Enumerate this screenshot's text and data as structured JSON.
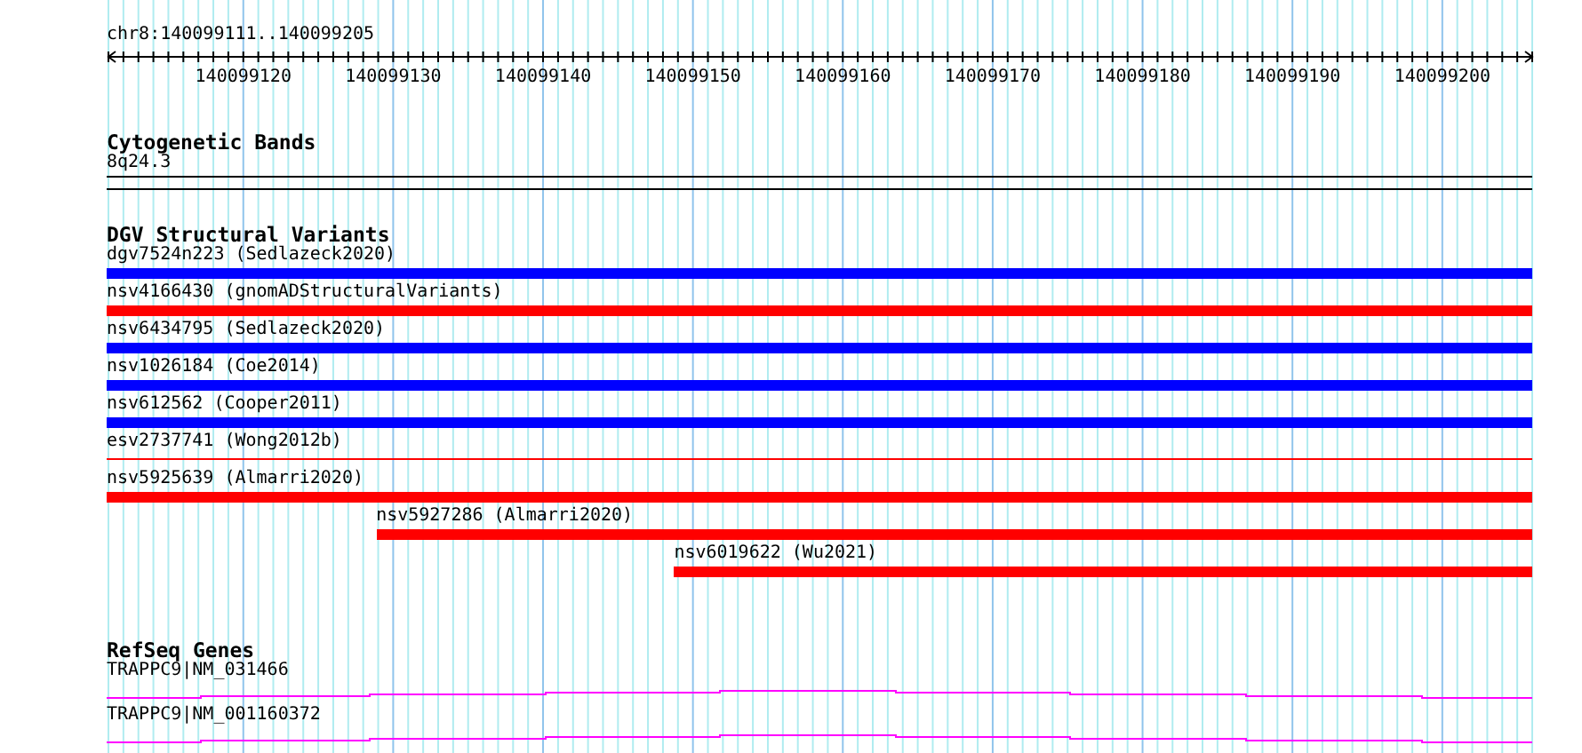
{
  "ruler": {
    "title": "chr8:140099111..140099205",
    "labels": [
      "140099120",
      "140099130",
      "140099140",
      "140099150",
      "140099160",
      "140099170",
      "140099180",
      "140099190",
      "140099200"
    ]
  },
  "cytogenetic_bands": {
    "title": "Cytogenetic Bands",
    "bands": [
      {
        "label": "8q24.3"
      }
    ]
  },
  "dgv_structural_variants": {
    "title": "DGV Structural Variants",
    "features": [
      {
        "label": "dgv7524n223 (Sedlazeck2020)",
        "color": "#0000ff",
        "kind": "thick"
      },
      {
        "label": "nsv4166430 (gnomADStructuralVariants)",
        "color": "#ff0000",
        "kind": "thick"
      },
      {
        "label": "nsv6434795 (Sedlazeck2020)",
        "color": "#0000ff",
        "kind": "thick"
      },
      {
        "label": "nsv1026184 (Coe2014)",
        "color": "#0000ff",
        "kind": "thick"
      },
      {
        "label": "nsv612562 (Cooper2011)",
        "color": "#0000ff",
        "kind": "thick"
      },
      {
        "label": "esv2737741 (Wong2012b)",
        "color": "#ff0000",
        "kind": "thin"
      },
      {
        "label": "nsv5925639 (Almarri2020)",
        "color": "#ff0000",
        "kind": "thick"
      },
      {
        "label": "nsv5927286 (Almarri2020)",
        "color": "#ff0000",
        "kind": "thick"
      },
      {
        "label": "nsv6019622 (Wu2021)",
        "color": "#ff0000",
        "kind": "thick"
      }
    ]
  },
  "refseq_genes": {
    "title": "RefSeq Genes",
    "genes": [
      {
        "label": "TRAPPC9|NM_031466"
      },
      {
        "label": "TRAPPC9|NM_001160372"
      }
    ]
  }
}
